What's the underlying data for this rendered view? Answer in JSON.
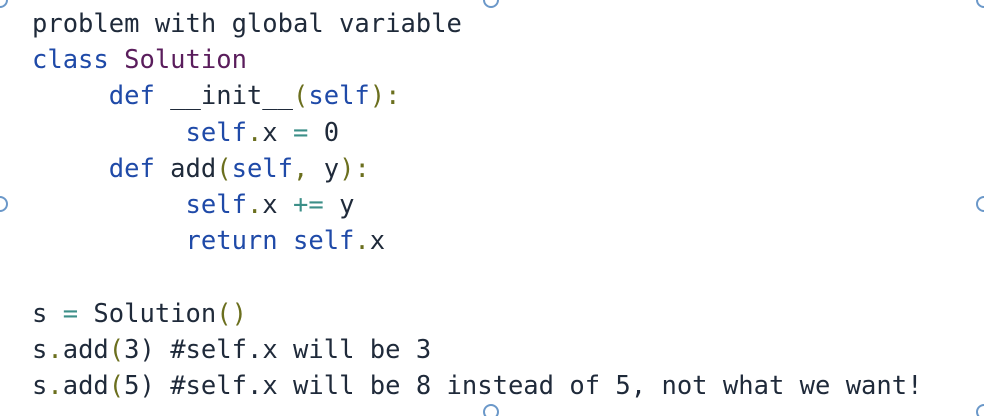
{
  "code": {
    "lines": [
      [
        {
          "t": "problem with global variable",
          "c": "id"
        }
      ],
      [
        {
          "t": "class ",
          "c": "kw"
        },
        {
          "t": "Solution",
          "c": "cls"
        }
      ],
      [
        {
          "t": "     def ",
          "c": "kw"
        },
        {
          "t": "__init__",
          "c": "id"
        },
        {
          "t": "(",
          "c": "pun"
        },
        {
          "t": "self",
          "c": "self"
        },
        {
          "t": "):",
          "c": "pun"
        }
      ],
      [
        {
          "t": "          self",
          "c": "self"
        },
        {
          "t": ".",
          "c": "pun"
        },
        {
          "t": "x ",
          "c": "id"
        },
        {
          "t": "=",
          "c": "op"
        },
        {
          "t": " 0",
          "c": "num"
        }
      ],
      [
        {
          "t": "     def ",
          "c": "kw"
        },
        {
          "t": "add",
          "c": "id"
        },
        {
          "t": "(",
          "c": "pun"
        },
        {
          "t": "self",
          "c": "self"
        },
        {
          "t": ", ",
          "c": "pun"
        },
        {
          "t": "y",
          "c": "id"
        },
        {
          "t": "):",
          "c": "pun"
        }
      ],
      [
        {
          "t": "          self",
          "c": "self"
        },
        {
          "t": ".",
          "c": "pun"
        },
        {
          "t": "x ",
          "c": "id"
        },
        {
          "t": "+=",
          "c": "op"
        },
        {
          "t": " y",
          "c": "id"
        }
      ],
      [
        {
          "t": "          return ",
          "c": "kw"
        },
        {
          "t": "self",
          "c": "self"
        },
        {
          "t": ".",
          "c": "pun"
        },
        {
          "t": "x",
          "c": "id"
        }
      ],
      [
        {
          "t": "",
          "c": "id"
        }
      ],
      [
        {
          "t": "s ",
          "c": "id"
        },
        {
          "t": "=",
          "c": "op"
        },
        {
          "t": " Solution",
          "c": "id"
        },
        {
          "t": "()",
          "c": "pun"
        }
      ],
      [
        {
          "t": "s",
          "c": "id"
        },
        {
          "t": ".",
          "c": "pun"
        },
        {
          "t": "add",
          "c": "id"
        },
        {
          "t": "(",
          "c": "pun"
        },
        {
          "t": "3",
          "c": "num"
        },
        {
          "t": ") #self.x will be 3",
          "c": "cm"
        }
      ],
      [
        {
          "t": "s",
          "c": "id"
        },
        {
          "t": ".",
          "c": "pun"
        },
        {
          "t": "add",
          "c": "id"
        },
        {
          "t": "(",
          "c": "pun"
        },
        {
          "t": "5",
          "c": "num"
        },
        {
          "t": ") #self.x will be 8 instead of 5, not what we want!",
          "c": "cm"
        }
      ]
    ]
  },
  "colors": {
    "keyword": "#1f4aa8",
    "class_name": "#5a1d5c",
    "punctuation": "#6b6f1e",
    "operator": "#3c8f88",
    "text": "#1f2a3a",
    "handle_border": "#6b98c9"
  },
  "selection_handles": [
    {
      "name": "selection-handle-top-left"
    },
    {
      "name": "selection-handle-top-middle"
    },
    {
      "name": "selection-handle-top-right"
    },
    {
      "name": "selection-handle-middle-left"
    },
    {
      "name": "selection-handle-middle-right"
    },
    {
      "name": "selection-handle-bottom-middle"
    },
    {
      "name": "selection-handle-bottom-right"
    }
  ]
}
